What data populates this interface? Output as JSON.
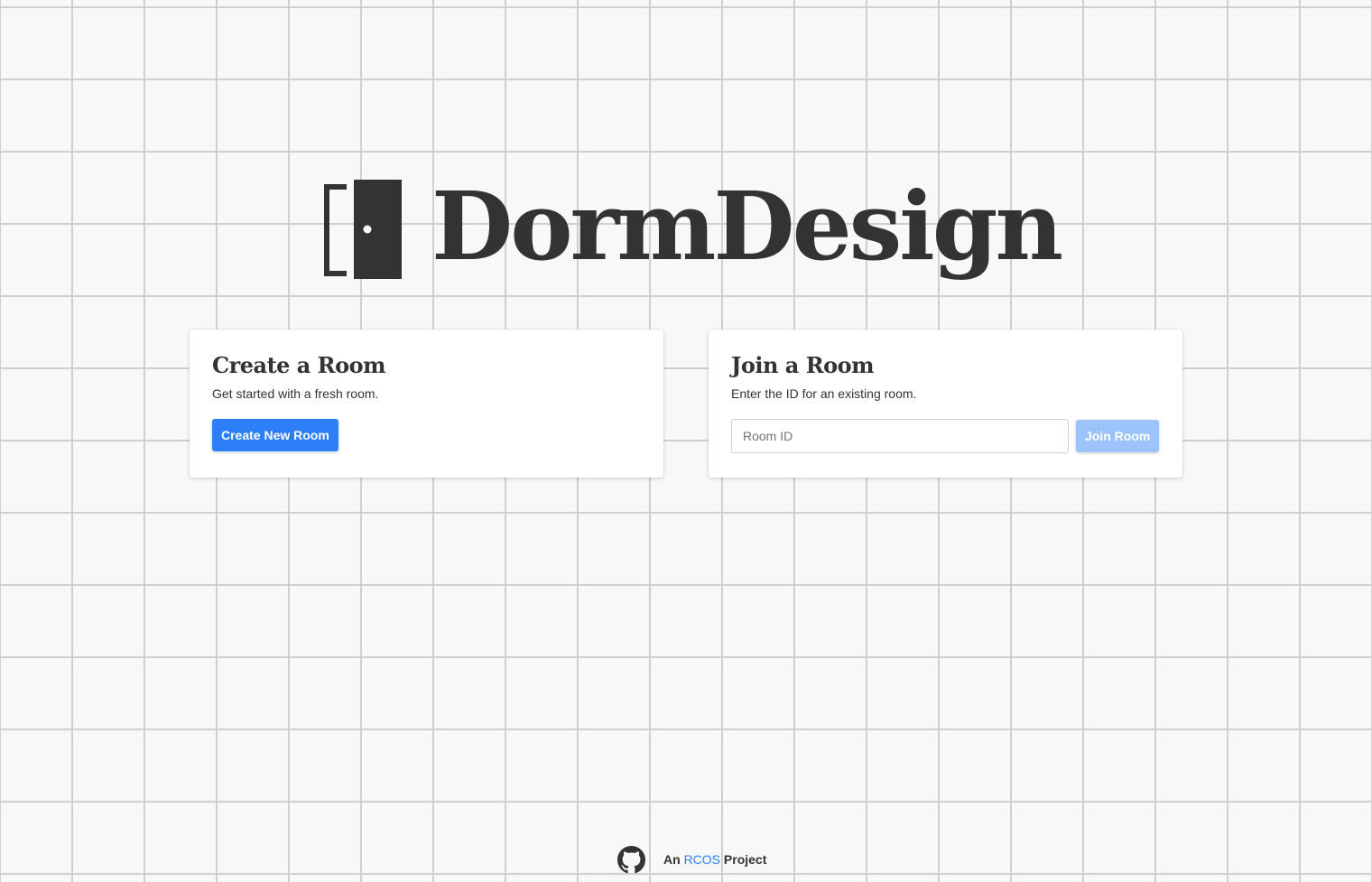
{
  "brand": {
    "name": "DormDesign",
    "icon": "door-icon",
    "color": "#333333"
  },
  "create_card": {
    "title": "Create a Room",
    "description": "Get started with a fresh room.",
    "button_label": "Create New Room"
  },
  "join_card": {
    "title": "Join a Room",
    "description": "Enter the ID for an existing room.",
    "input_placeholder": "Room ID",
    "input_value": "",
    "button_label": "Join Room",
    "button_enabled": false
  },
  "footer": {
    "icon": "github-icon",
    "prefix": "An",
    "link_text": "RCOS",
    "suffix": "Project"
  },
  "colors": {
    "accent": "#2d7ff9",
    "accent_disabled": "#9cc3fb",
    "text": "#333333",
    "background": "#f8f8f8",
    "grid_line": "#cfcfcf"
  }
}
